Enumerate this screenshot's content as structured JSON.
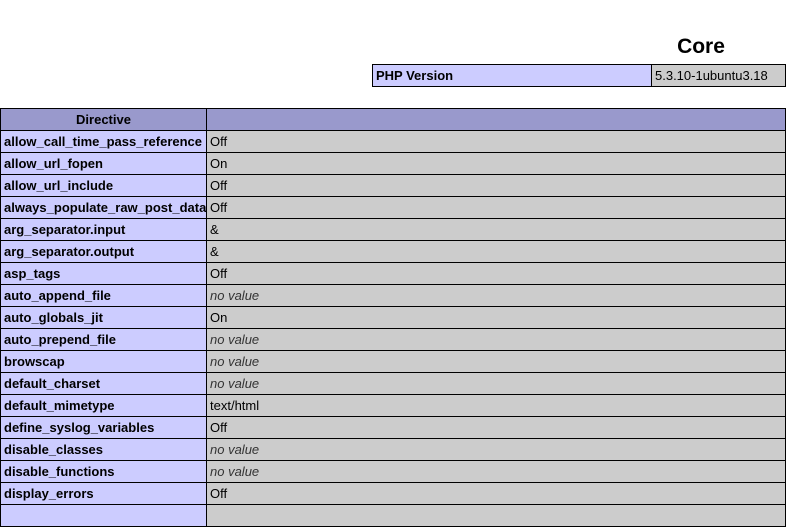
{
  "section_title": "Core",
  "version": {
    "label": "PHP Version",
    "value": "5.3.10-1ubuntu3.18"
  },
  "table": {
    "header_directive": "Directive",
    "header_value": "",
    "rows": [
      {
        "name": "allow_call_time_pass_reference",
        "value": "Off",
        "no_value": false
      },
      {
        "name": "allow_url_fopen",
        "value": "On",
        "no_value": false
      },
      {
        "name": "allow_url_include",
        "value": "Off",
        "no_value": false
      },
      {
        "name": "always_populate_raw_post_data",
        "value": "Off",
        "no_value": false
      },
      {
        "name": "arg_separator.input",
        "value": "&",
        "no_value": false
      },
      {
        "name": "arg_separator.output",
        "value": "&",
        "no_value": false
      },
      {
        "name": "asp_tags",
        "value": "Off",
        "no_value": false
      },
      {
        "name": "auto_append_file",
        "value": "no value",
        "no_value": true
      },
      {
        "name": "auto_globals_jit",
        "value": "On",
        "no_value": false
      },
      {
        "name": "auto_prepend_file",
        "value": "no value",
        "no_value": true
      },
      {
        "name": "browscap",
        "value": "no value",
        "no_value": true
      },
      {
        "name": "default_charset",
        "value": "no value",
        "no_value": true
      },
      {
        "name": "default_mimetype",
        "value": "text/html",
        "no_value": false
      },
      {
        "name": "define_syslog_variables",
        "value": "Off",
        "no_value": false
      },
      {
        "name": "disable_classes",
        "value": "no value",
        "no_value": true
      },
      {
        "name": "disable_functions",
        "value": "no value",
        "no_value": true
      },
      {
        "name": "display_errors",
        "value": "Off",
        "no_value": false
      },
      {
        "name": "",
        "value": "",
        "no_value": false
      }
    ]
  },
  "colors": {
    "header_bg": "#9999cc",
    "directive_bg": "#ccccff",
    "value_bg": "#cccccc"
  }
}
